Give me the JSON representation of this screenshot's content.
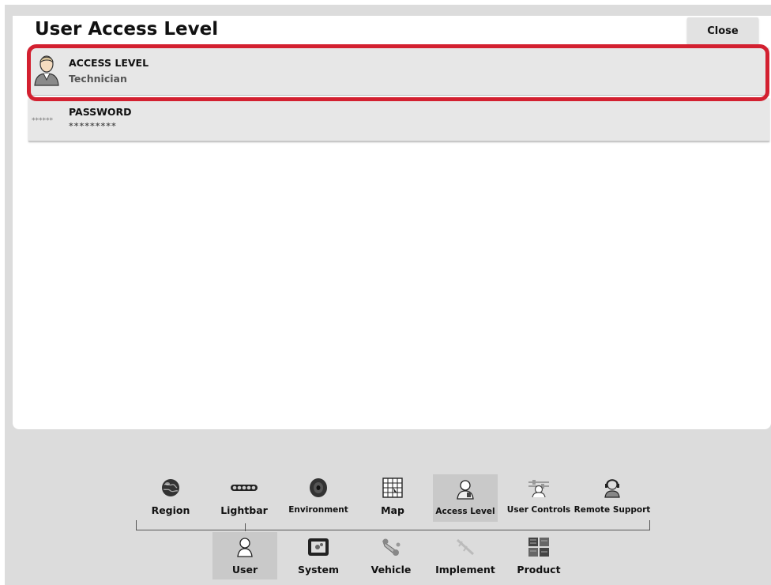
{
  "header": {
    "title": "User Access Level",
    "close_label": "Close"
  },
  "rows": [
    {
      "label": "ACCESS LEVEL",
      "value": "Technician",
      "icon": "user-avatar-icon"
    },
    {
      "label": "PASSWORD",
      "value": "*********",
      "icon": "password-dots-icon",
      "icon_text": "******"
    }
  ],
  "nav": {
    "top_tabs": [
      {
        "label": "Region",
        "icon": "globe-icon"
      },
      {
        "label": "Lightbar",
        "icon": "lightbar-icon"
      },
      {
        "label": "Environment",
        "icon": "speaker-icon"
      },
      {
        "label": "Map",
        "icon": "map-grid-icon"
      },
      {
        "label": "Access Level",
        "icon": "access-level-icon"
      },
      {
        "label": "User Controls",
        "icon": "user-controls-icon"
      },
      {
        "label": "Remote Support",
        "icon": "remote-support-icon"
      }
    ],
    "active_top": "Access Level",
    "bottom_tabs": [
      {
        "label": "User",
        "icon": "user-icon"
      },
      {
        "label": "System",
        "icon": "system-icon"
      },
      {
        "label": "Vehicle",
        "icon": "vehicle-icon"
      },
      {
        "label": "Implement",
        "icon": "implement-icon"
      },
      {
        "label": "Product",
        "icon": "product-icon"
      }
    ],
    "active_bottom": "User"
  },
  "colors": {
    "highlight": "#d32030",
    "row_bg": "#e7e7e7",
    "nav_active_bg": "#c9c9c9"
  }
}
